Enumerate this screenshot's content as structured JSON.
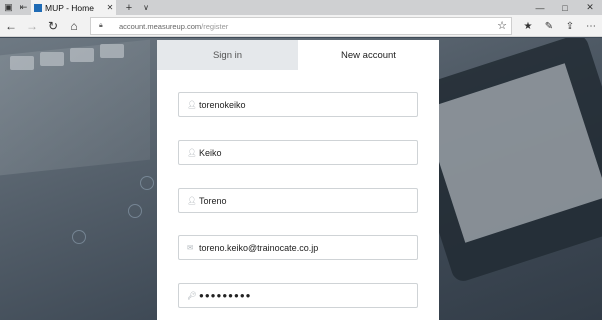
{
  "tabbar": {
    "tab_title": "MUP - Home",
    "new_tab_label": "+",
    "tab_list_label": "∨"
  },
  "window": {
    "minimize": "—",
    "maximize": "□",
    "close": "✕"
  },
  "navbar": {
    "url_host": "account.measureup.com",
    "url_path": "/register"
  },
  "icons": {
    "back": "back-arrow-icon",
    "forward": "forward-arrow-icon",
    "refresh": "refresh-icon",
    "home": "home-icon",
    "lock": "lock-icon",
    "favorite": "star-icon",
    "favorites_hub": "favorites-icon",
    "reading": "pen-icon",
    "share": "share-icon",
    "more": "more-icon"
  },
  "form": {
    "tabs": [
      {
        "label": "Sign in",
        "active": false
      },
      {
        "label": "New account",
        "active": true
      }
    ],
    "fields": {
      "username": "torenokeiko",
      "first_name": "Keiko",
      "last_name": "Toreno",
      "email": "toreno.keiko@trainocate.co.jp",
      "password": "●●●●●●●●●"
    }
  },
  "colors": {
    "inactive_tab_bg": "#e5e8eb",
    "field_border": "#cfd3d6",
    "page_bg": "#3e4a57",
    "favicon": "#1f6bb5"
  }
}
